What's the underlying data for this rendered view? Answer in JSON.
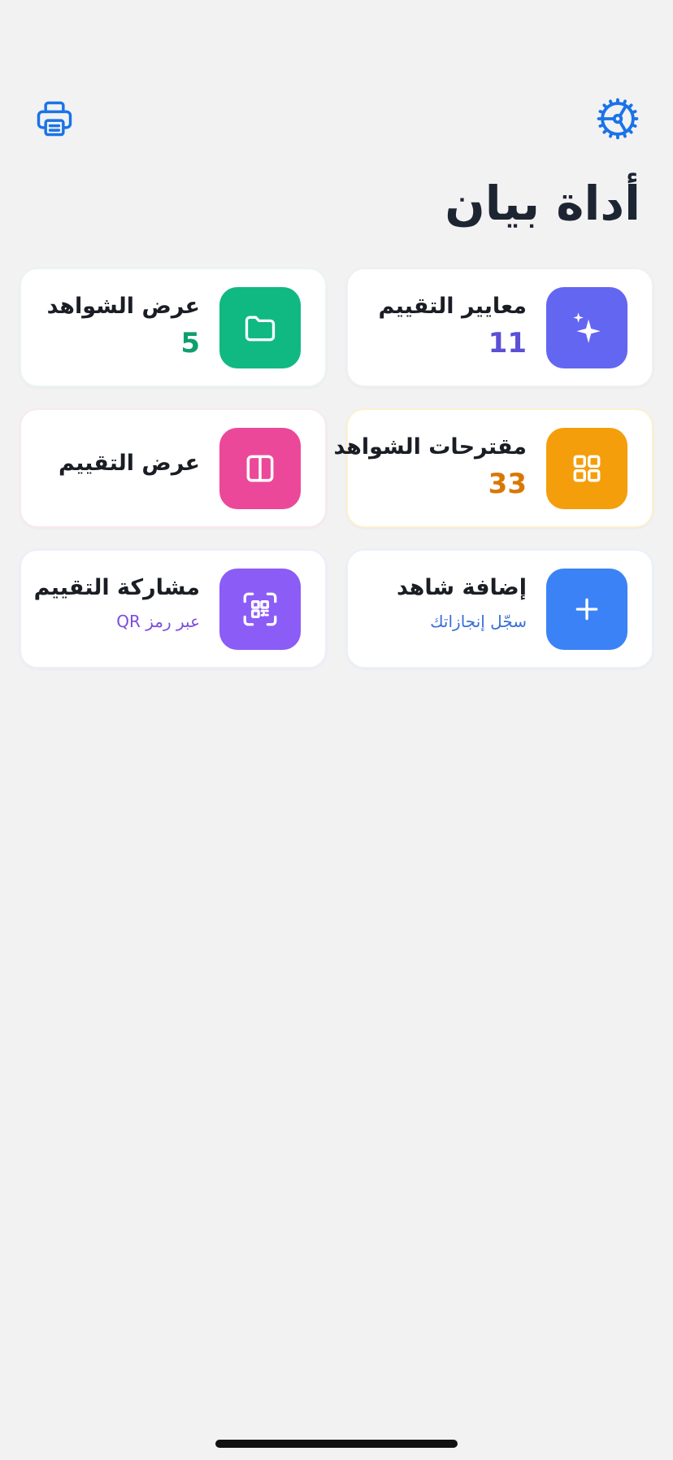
{
  "header": {
    "title": "أداة بيان",
    "print_icon": "printer-icon",
    "settings_icon": "gear-icon"
  },
  "colors": {
    "accent": "#1a73e8",
    "indigo": "#6366f1",
    "green": "#10b981",
    "amber": "#f59e0b",
    "pink": "#ec4899",
    "blue": "#3b82f6",
    "purple": "#8b5cf6"
  },
  "cards": {
    "criteria": {
      "title": "معايير التقييم",
      "count": "11",
      "icon": "sparkles-icon"
    },
    "evidence": {
      "title": "عرض الشواهد",
      "count": "5",
      "icon": "folder-icon"
    },
    "suggestions": {
      "title": "مقترحات الشواهد",
      "count": "33",
      "icon": "grid-icon"
    },
    "view_evaluation": {
      "title": "عرض التقييم",
      "icon": "columns-icon"
    },
    "add_evidence": {
      "title": "إضافة شاهد",
      "subtitle": "سجّل إنجازاتك",
      "icon": "plus-icon"
    },
    "share_evaluation": {
      "title": "مشاركة التقييم",
      "subtitle": "عبر رمز QR",
      "icon": "qr-code-icon"
    }
  }
}
